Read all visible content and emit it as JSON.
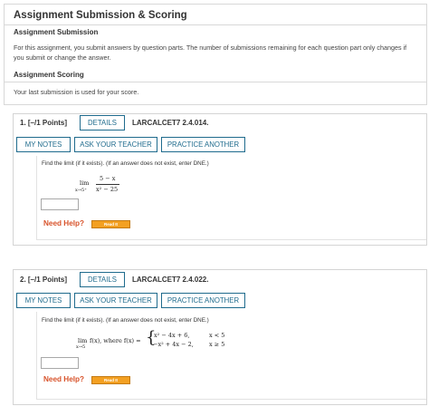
{
  "page": {
    "title": "Assignment Submission & Scoring",
    "submission_heading": "Assignment Submission",
    "submission_text": "For this assignment, you submit answers by question parts. The number of submissions remaining for each question part only changes if you submit or change the answer.",
    "scoring_heading": "Assignment Scoring",
    "scoring_text": "Your last submission is used for your score."
  },
  "questions": [
    {
      "label": "1. [–/1 Points]",
      "details": "DETAILS",
      "code": "LARCALCET7 2.4.014.",
      "my_notes": "MY NOTES",
      "ask_teacher": "ASK YOUR TEACHER",
      "practice": "PRACTICE ANOTHER",
      "prompt": "Find the limit (if it exists). (If an answer does not exist, enter DNE.)",
      "lim": "lim",
      "lim_sub": "x→5⁺",
      "numerator": "5 − x",
      "denominator": "x² − 25",
      "need_help": "Need Help?",
      "read_it": "Read It"
    },
    {
      "label": "2. [–/1 Points]",
      "details": "DETAILS",
      "code": "LARCALCET7 2.4.022.",
      "my_notes": "MY NOTES",
      "ask_teacher": "ASK YOUR TEACHER",
      "practice": "PRACTICE ANOTHER",
      "prompt": "Find the limit (if it exists). (If an answer does not exist, enter DNE.)",
      "lim": "lim",
      "lim_sub": "x→5",
      "expr": "f(x), where f(x) =",
      "case1": "x² − 4x + 6,",
      "cond1": "x < 5",
      "case2": "−x² + 4x − 2,",
      "cond2": "x ≥ 5",
      "need_help": "Need Help?",
      "read_it": "Read It"
    }
  ]
}
